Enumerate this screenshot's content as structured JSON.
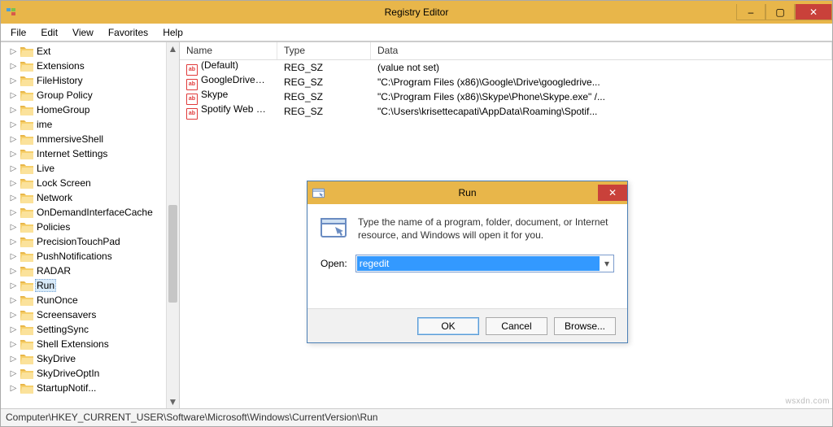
{
  "window": {
    "title": "Registry Editor",
    "controls": {
      "minimize": "–",
      "maximize": "▢",
      "close": "✕"
    }
  },
  "menu": [
    "File",
    "Edit",
    "View",
    "Favorites",
    "Help"
  ],
  "tree": {
    "items": [
      {
        "label": "Ext"
      },
      {
        "label": "Extensions"
      },
      {
        "label": "FileHistory"
      },
      {
        "label": "Group Policy"
      },
      {
        "label": "HomeGroup"
      },
      {
        "label": "ime"
      },
      {
        "label": "ImmersiveShell"
      },
      {
        "label": "Internet Settings"
      },
      {
        "label": "Live"
      },
      {
        "label": "Lock Screen"
      },
      {
        "label": "Network"
      },
      {
        "label": "OnDemandInterfaceCache"
      },
      {
        "label": "Policies"
      },
      {
        "label": "PrecisionTouchPad"
      },
      {
        "label": "PushNotifications"
      },
      {
        "label": "RADAR"
      },
      {
        "label": "Run",
        "selected": true,
        "open": true
      },
      {
        "label": "RunOnce"
      },
      {
        "label": "Screensavers"
      },
      {
        "label": "SettingSync"
      },
      {
        "label": "Shell Extensions"
      },
      {
        "label": "SkyDrive"
      },
      {
        "label": "SkyDriveOptIn"
      },
      {
        "label": "StartupNotif..."
      }
    ]
  },
  "columns": {
    "name": "Name",
    "type": "Type",
    "data": "Data"
  },
  "values": [
    {
      "name": "(Default)",
      "type": "REG_SZ",
      "data": "(value not set)"
    },
    {
      "name": "GoogleDriveSync",
      "type": "REG_SZ",
      "data": "\"C:\\Program Files (x86)\\Google\\Drive\\googledrive..."
    },
    {
      "name": "Skype",
      "type": "REG_SZ",
      "data": "\"C:\\Program Files (x86)\\Skype\\Phone\\Skype.exe\" /..."
    },
    {
      "name": "Spotify Web Hel...",
      "type": "REG_SZ",
      "data": "\"C:\\Users\\krisettecapati\\AppData\\Roaming\\Spotif..."
    }
  ],
  "statusbar": "Computer\\HKEY_CURRENT_USER\\Software\\Microsoft\\Windows\\CurrentVersion\\Run",
  "run": {
    "title": "Run",
    "desc": "Type the name of a program, folder, document, or Internet resource, and Windows will open it for you.",
    "open_label": "Open:",
    "value": "regedit",
    "ok": "OK",
    "cancel": "Cancel",
    "browse": "Browse..."
  },
  "watermark": "wsxdn.com"
}
